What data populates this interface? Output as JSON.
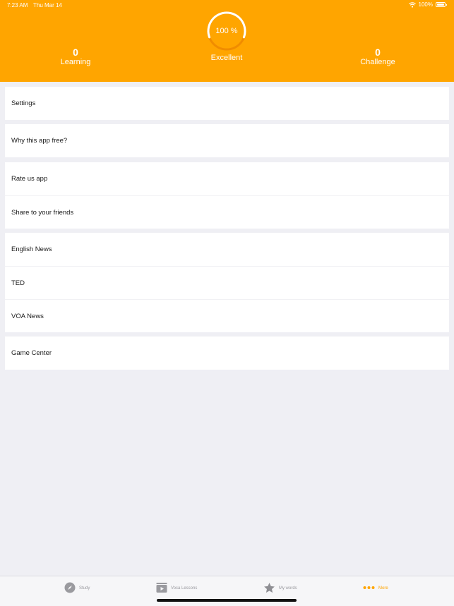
{
  "status_bar": {
    "time": "7:23 AM",
    "date": "Thu Mar 14",
    "battery": "100%"
  },
  "header": {
    "progress_label": "100 %",
    "progress_value": 1.0,
    "rating": "Excellent",
    "learning": {
      "count": "0",
      "label": "Learning"
    },
    "challenge": {
      "count": "0",
      "label": "Challenge"
    },
    "accent_color": "#ffa500"
  },
  "menu": {
    "settings": "Settings",
    "why_free": "Why this app free?",
    "rate_us": "Rate us app",
    "share": "Share to your friends",
    "english_news": "English News",
    "ted": "TED",
    "voa_news": "VOA News",
    "game_center": "Game Center"
  },
  "tab_bar": {
    "study": {
      "label": "Study",
      "icon": "compass-icon"
    },
    "voca_lessons": {
      "label": "Voca Lessons",
      "icon": "video-icon"
    },
    "my_words": {
      "label": "My words",
      "icon": "star-icon"
    },
    "more": {
      "label": "More",
      "icon": "more-dots-icon",
      "active": true
    }
  }
}
